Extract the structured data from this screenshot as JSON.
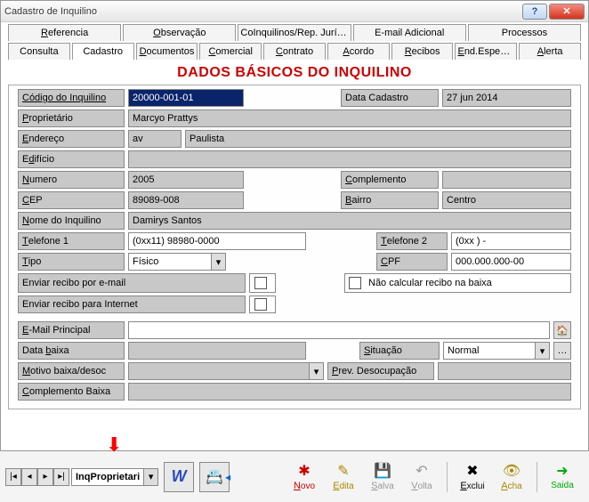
{
  "window": {
    "title": "Cadastro de Inquilino"
  },
  "tabs_top": [
    {
      "label": "Referencia",
      "ul": "R"
    },
    {
      "label": "Observação",
      "ul": "O"
    },
    {
      "label": "CoInquilinos/Rep. Jurídico"
    },
    {
      "label": "E-mail Adicional"
    },
    {
      "label": "Processos"
    }
  ],
  "tabs_bottom": [
    {
      "label": "Consulta",
      "ul": ""
    },
    {
      "label": "Cadastro",
      "active": true
    },
    {
      "label": "Documentos",
      "ul": "D"
    },
    {
      "label": "Comercial",
      "ul": "C"
    },
    {
      "label": "Contrato",
      "ul": "C"
    },
    {
      "label": "Acordo",
      "ul": "A"
    },
    {
      "label": "Recibos",
      "ul": "R"
    },
    {
      "label": "End.Especial",
      "ul": "E"
    },
    {
      "label": "Alerta",
      "ul": "A"
    }
  ],
  "section_title": "DADOS BÁSICOS DO INQUILINO",
  "labels": {
    "codigo": "Código do Inquilino",
    "data_cadastro": "Data Cadastro",
    "proprietario": "Proprietário",
    "endereco": "Endereço",
    "edificio": "Edifício",
    "numero": "Numero",
    "complemento": "Complemento",
    "cep": "CEP",
    "bairro": "Bairro",
    "nome": "Nome do Inquilino",
    "tel1": "Telefone 1",
    "tel2": "Telefone 2",
    "tipo": "Tipo",
    "cpf": "CPF",
    "enviar_email": "Enviar recibo por e-mail",
    "nao_calcular": "Não calcular recibo na baixa",
    "enviar_internet": "Enviar recibo para Internet",
    "email_principal": "E-Mail Principal",
    "data_baixa": "Data baixa",
    "situacao": "Situação",
    "motivo": "Motivo baixa/desoc",
    "prev_desoc": "Prev. Desocupação",
    "compl_baixa": "Complemento Baixa"
  },
  "values": {
    "codigo": "20000-001-01",
    "data_cadastro": "27 jun 2014",
    "proprietario": "Marcyo Prattys",
    "endereco_pre": "av",
    "endereco": "Paulista",
    "edificio": "",
    "numero": "2005",
    "complemento": "",
    "cep": "89089-008",
    "bairro": "Centro",
    "nome": "Damirys Santos",
    "tel1": "(0xx11) 98980-0000",
    "tel2": "(0xx  )       -",
    "tipo": "Físico",
    "cpf": "000.000.000-00",
    "email_principal": "",
    "data_baixa": "",
    "situacao": "Normal",
    "motivo": "",
    "prev_desoc": "",
    "compl_baixa": ""
  },
  "footer": {
    "combo": "InqProprietari",
    "tools": [
      {
        "label": "Novo",
        "ul": "N",
        "color": "#c00",
        "icon": "✱"
      },
      {
        "label": "Edita",
        "ul": "E",
        "color": "#a80",
        "icon": "✎"
      },
      {
        "label": "Salva",
        "ul": "S",
        "color": "#999",
        "icon": "💾",
        "disabled": true
      },
      {
        "label": "Volta",
        "ul": "V",
        "color": "#999",
        "icon": "↶",
        "disabled": true
      },
      {
        "label": "Exclui",
        "ul": "E",
        "color": "#000",
        "icon": "✖"
      },
      {
        "label": "Acha",
        "ul": "A",
        "color": "#a80",
        "icon": "👁"
      },
      {
        "label": "Saida",
        "ul": "",
        "color": "#0a0",
        "icon": "➜"
      }
    ]
  }
}
